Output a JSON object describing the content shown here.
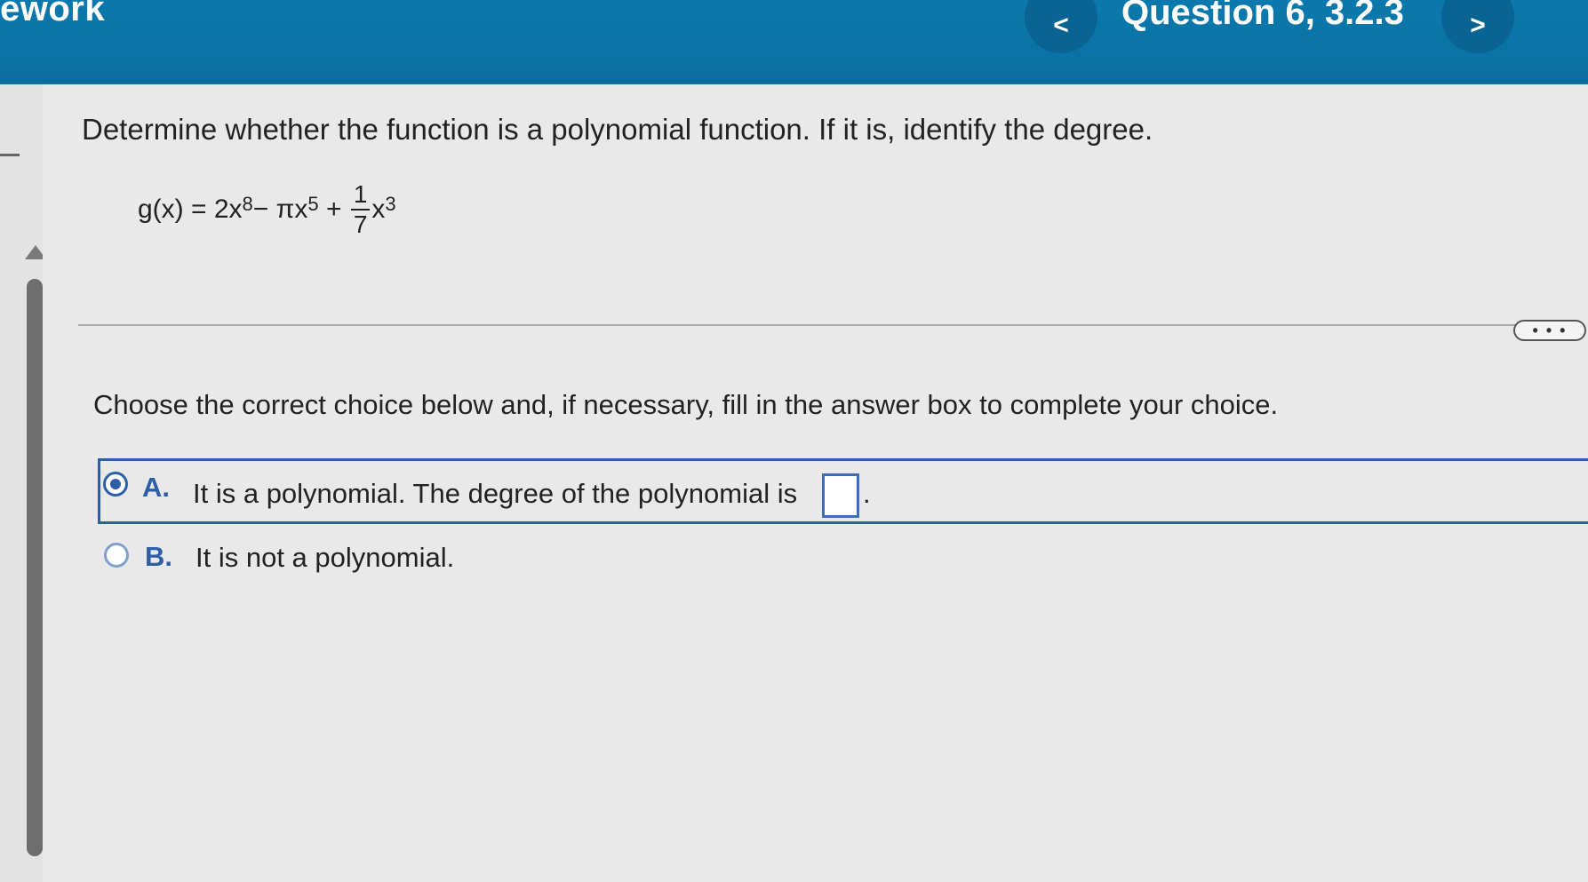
{
  "header": {
    "brand": "ework",
    "prev_label": "<",
    "next_label": ">",
    "question_title": "Question 6, 3.2.3"
  },
  "question": {
    "prompt": "Determine whether the function is a polynomial function. If it is, identify the degree.",
    "equation": {
      "lhs": "g(x) = 2x",
      "exp1": "8",
      "mid": " − πx",
      "exp2": "5",
      "plus": " + ",
      "frac_num": "1",
      "frac_den": "7",
      "var": "x",
      "exp3": "3"
    }
  },
  "more_label": "• • •",
  "instruction": "Choose the correct choice below and, if necessary, fill in the answer box to complete your choice.",
  "choices": [
    {
      "letter": "A.",
      "text": "It is a polynomial. The degree of the polynomial is",
      "selected": true,
      "answer_value": "",
      "suffix": "."
    },
    {
      "letter": "B.",
      "text": "It is not a polynomial.",
      "selected": false
    }
  ],
  "colors": {
    "header_bg": "#0b79ad",
    "accent": "#2d5fa8",
    "background": "#ececec"
  }
}
